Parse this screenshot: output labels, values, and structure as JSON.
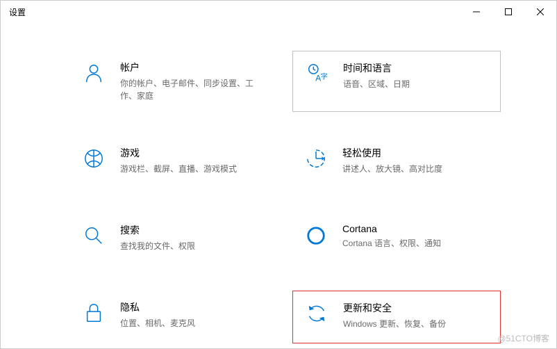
{
  "window": {
    "title": "设置"
  },
  "items": {
    "accounts": {
      "title": "帐户",
      "desc": "你的帐户、电子邮件、同步设置、工作、家庭"
    },
    "timeLanguage": {
      "title": "时间和语言",
      "desc": "语音、区域、日期"
    },
    "gaming": {
      "title": "游戏",
      "desc": "游戏栏、截屏、直播、游戏模式"
    },
    "easeOfAccess": {
      "title": "轻松使用",
      "desc": "讲述人、放大镜、高对比度"
    },
    "search": {
      "title": "搜索",
      "desc": "查找我的文件、权限"
    },
    "cortana": {
      "title": "Cortana",
      "desc": "Cortana 语言、权限、通知"
    },
    "privacy": {
      "title": "隐私",
      "desc": "位置、相机、麦克风"
    },
    "updateSecurity": {
      "title": "更新和安全",
      "desc": "Windows 更新、恢复、备份"
    }
  },
  "watermark": "@51CTO博客"
}
